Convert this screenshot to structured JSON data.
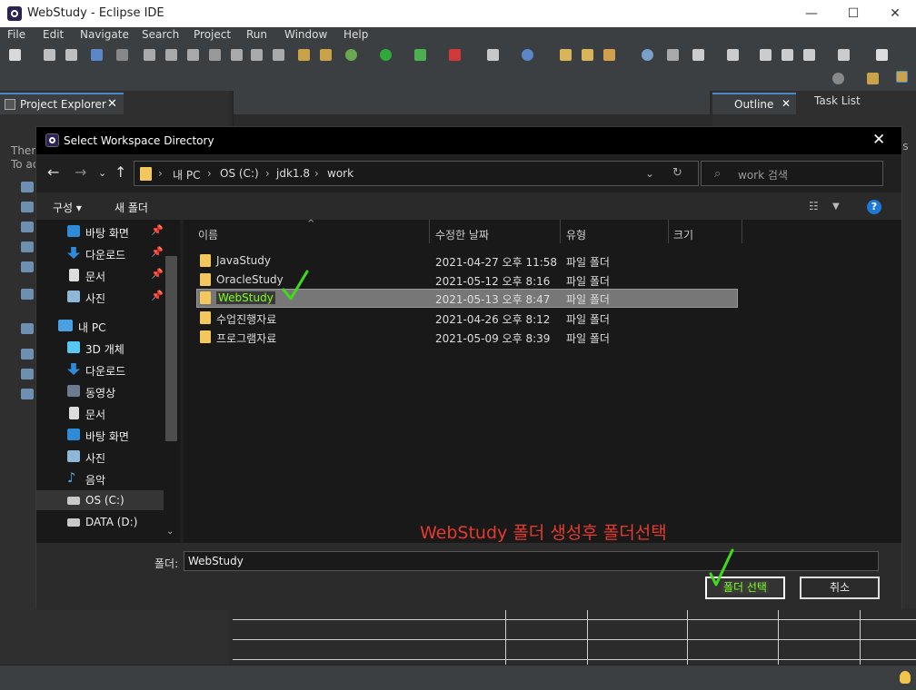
{
  "window": {
    "title": "WebStudy - Eclipse IDE",
    "min": "—",
    "max": "☐",
    "close": "✕"
  },
  "menu": [
    "File",
    "Edit",
    "Navigate",
    "Search",
    "Project",
    "Run",
    "Window",
    "Help"
  ],
  "left_view": {
    "tab_label": "Project Explorer",
    "msg_line1": "There",
    "msg_line2": "To ac"
  },
  "right_view": {
    "outline_label": "Outline",
    "tasklist_label": "Task List",
    "edge_text": "es"
  },
  "dialog": {
    "title": "Select Workspace Directory",
    "breadcrumb": [
      "내 PC",
      "OS (C:)",
      "jdk1.8",
      "work"
    ],
    "search_placeholder": "work 검색",
    "organize_label": "구성 ▾",
    "new_folder_label": "새 폴더",
    "help_label": "?",
    "nav_items": [
      {
        "label": "바탕 화면",
        "pinned": true
      },
      {
        "label": "다운로드",
        "pinned": true
      },
      {
        "label": "문서",
        "pinned": true
      },
      {
        "label": "사진",
        "pinned": true
      },
      {
        "label": "내 PC",
        "pinned": false
      },
      {
        "label": "3D 개체",
        "pinned": false
      },
      {
        "label": "다운로드",
        "pinned": false
      },
      {
        "label": "동영상",
        "pinned": false
      },
      {
        "label": "문서",
        "pinned": false
      },
      {
        "label": "바탕 화면",
        "pinned": false
      },
      {
        "label": "사진",
        "pinned": false
      },
      {
        "label": "음악",
        "pinned": false
      },
      {
        "label": "OS (C:)",
        "pinned": false,
        "selected": true
      },
      {
        "label": "DATA (D:)",
        "pinned": false
      }
    ],
    "columns": {
      "name": "이름",
      "modified": "수정한 날짜",
      "type": "유형",
      "size": "크기"
    },
    "files": [
      {
        "name": "JavaStudy",
        "modified": "2021-04-27 오후 11:58",
        "type": "파일 폴더"
      },
      {
        "name": "OracleStudy",
        "modified": "2021-05-12 오후 8:16",
        "type": "파일 폴더"
      },
      {
        "name": "WebStudy",
        "modified": "2021-05-13 오후 8:47",
        "type": "파일 폴더",
        "selected": true
      },
      {
        "name": "수업진행자료",
        "modified": "2021-04-26 오후 8:12",
        "type": "파일 폴더"
      },
      {
        "name": "프로그램자료",
        "modified": "2021-05-09 오후 8:39",
        "type": "파일 폴더"
      }
    ],
    "annotation": "WebStudy 폴더 생성후 폴더선택",
    "folder_label": "폴더:",
    "folder_value": "WebStudy",
    "select_button": "폴더 선택",
    "cancel_button": "취소"
  },
  "colors": {
    "annotation": "#e63a2e",
    "checkmark": "#3ddc1a",
    "folder": "#f1c75e",
    "accent": "#4a88c7"
  }
}
